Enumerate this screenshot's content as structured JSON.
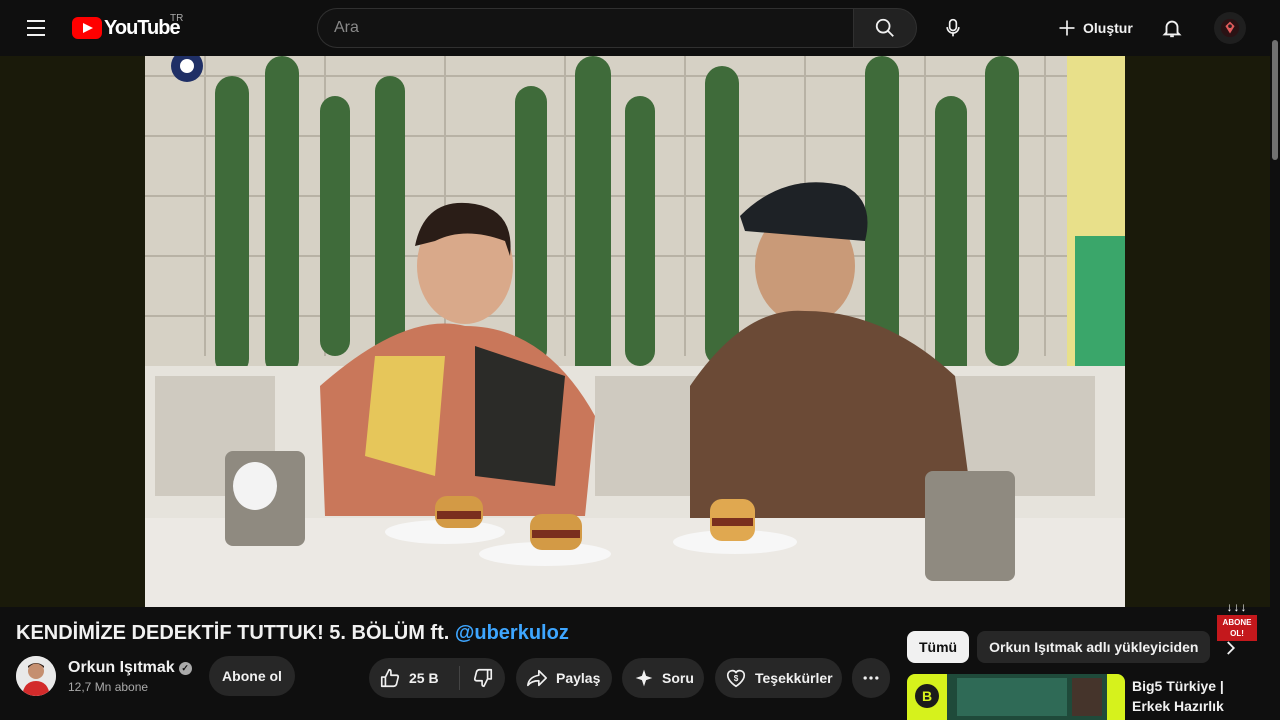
{
  "header": {
    "logo_text": "YouTube",
    "country_code": "TR",
    "search_placeholder": "Ara",
    "create_label": "Oluştur"
  },
  "video": {
    "title_main": "KENDİMİZE DEDEKTİF TUTTUK! 5. BÖLÜM ft. ",
    "title_mention": "@uberkuloz",
    "overlay_badge": "ABONE OL!"
  },
  "channel": {
    "name": "Orkun Işıtmak",
    "subscribers": "12,7 Mn abone",
    "subscribe_label": "Abone ol"
  },
  "actions": {
    "like_count": "25 B",
    "share_label": "Paylaş",
    "ask_label": "Soru",
    "thanks_label": "Teşekkürler"
  },
  "sidebar": {
    "chips": [
      {
        "label": "Tümü",
        "active": true
      },
      {
        "label": "Orkun Işıtmak adlı yükleyiciden",
        "active": false
      }
    ],
    "recommendation": {
      "title": "Big5 Türkiye | Erkek Hazırlık"
    }
  },
  "icons": {
    "menu": "menu-icon",
    "search": "search-icon",
    "mic": "mic-icon",
    "create": "plus-icon",
    "bell": "bell-icon",
    "like": "thumbs-up-icon",
    "dislike": "thumbs-down-icon",
    "share": "share-arrow-icon",
    "ask": "sparkle-icon",
    "thanks": "heart-dollar-icon",
    "more": "more-horizontal-icon",
    "next": "chevron-right-icon"
  },
  "colors": {
    "background": "#0f0f0f",
    "brand_red": "#ff0000",
    "link_blue": "#3ea6ff",
    "pill_bg": "#272727"
  }
}
